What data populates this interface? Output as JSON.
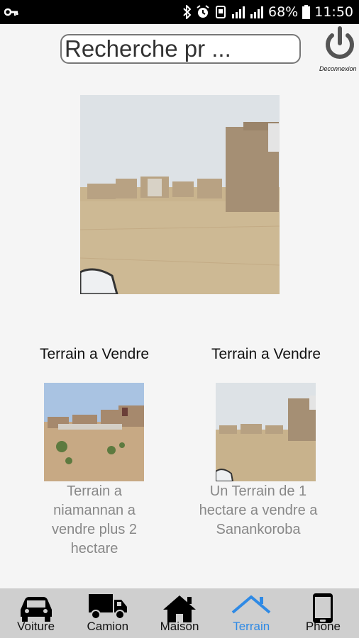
{
  "status_bar": {
    "battery": "68%",
    "time": "11:50"
  },
  "header": {
    "search_placeholder": "Recherche pr ...",
    "logout_label": "Deconnexion"
  },
  "featured": {
    "image_icon": "land-photo"
  },
  "listings": [
    {
      "title": "Terrain a Vendre",
      "description": "Terrain a niamannan a vendre plus 2 hectare",
      "image_icon": "land-photo"
    },
    {
      "title": "Terrain a Vendre",
      "description": "Un Terrain de 1 hectare a vendre a Sanankoroba",
      "image_icon": "land-photo"
    }
  ],
  "bottom_nav": {
    "items": [
      {
        "label": "Voiture",
        "icon": "car-icon"
      },
      {
        "label": "Camion",
        "icon": "truck-icon"
      },
      {
        "label": "Maison",
        "icon": "house-icon"
      },
      {
        "label": "Terrain",
        "icon": "land-icon",
        "active": true
      },
      {
        "label": "Phone",
        "icon": "phone-icon"
      }
    ],
    "active_color": "#2f8ae5"
  }
}
